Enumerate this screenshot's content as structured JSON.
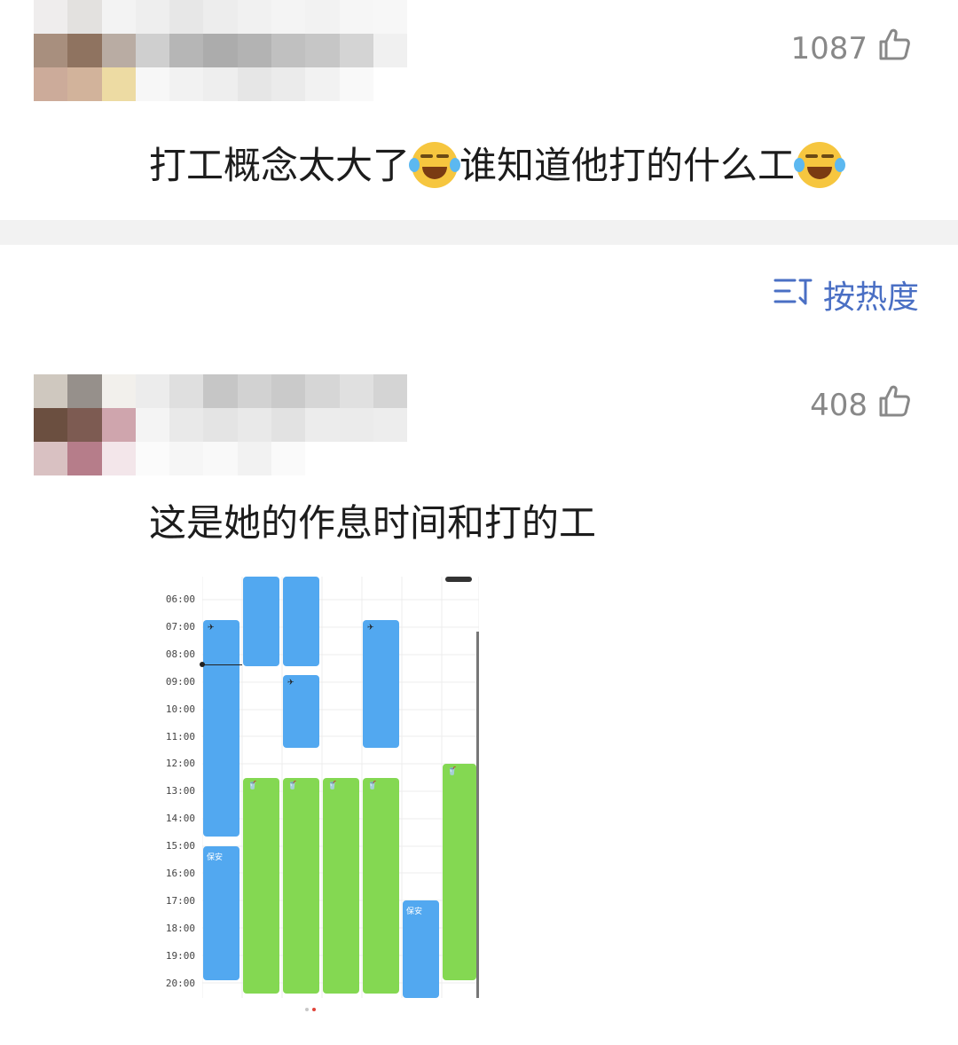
{
  "comments": [
    {
      "likes": "1087",
      "text_parts": [
        "打工概念太大了",
        "谁知道他打的什么工"
      ],
      "emoji": "crying-laughing-emoji"
    },
    {
      "likes": "408",
      "text": "这是她的作息时间和打的工",
      "attachment": {
        "times": [
          "06:00",
          "07:00",
          "08:00",
          "09:00",
          "10:00",
          "11:00",
          "12:00",
          "13:00",
          "14:00",
          "15:00",
          "16:00",
          "17:00",
          "18:00",
          "19:00",
          "20:00"
        ],
        "label_security": "保安",
        "colors": {
          "blue": "#52a8f0",
          "green": "#84d852"
        }
      }
    }
  ],
  "sort": {
    "label": "按热度",
    "icon": "sort-icon"
  },
  "icons": {
    "like": "thumbs-up-icon"
  }
}
